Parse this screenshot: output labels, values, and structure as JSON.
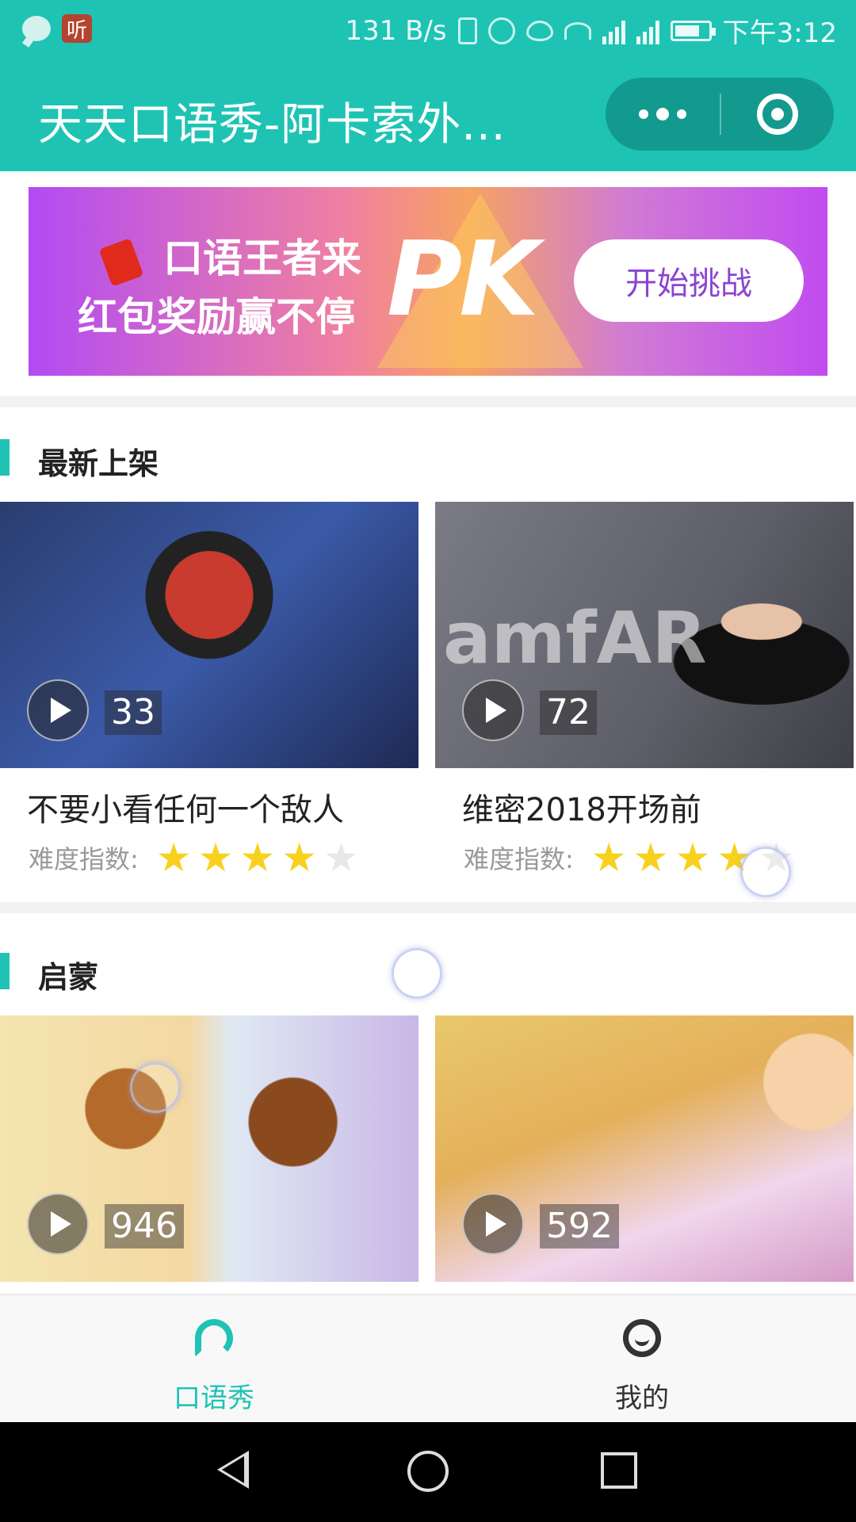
{
  "status_bar": {
    "speed": "131 B/s",
    "time": "下午3:12",
    "notif_badge": "听",
    "icons": [
      "chat-icon",
      "vibrate-icon",
      "alarm-icon",
      "eye-icon",
      "wifi-icon",
      "signal-4g-icon",
      "signal-2g-icon",
      "battery-icon"
    ]
  },
  "header": {
    "title": "天天口语秀-阿卡索外...",
    "accent_color": "#1ec3b4"
  },
  "banner": {
    "line1": "口语王者来",
    "line2": "红包奖励赢不停",
    "pk": "PK",
    "cta": "开始挑战"
  },
  "sections": [
    {
      "title": "最新上架",
      "cards": [
        {
          "title": "不要小看任何一个敌人",
          "count": "33",
          "difficulty_label": "难度指数:",
          "stars": 4,
          "max_stars": 5
        },
        {
          "title": "维密2018开场前",
          "count": "72",
          "difficulty_label": "难度指数:",
          "stars": 4,
          "max_stars": 5,
          "image_text": "amfAR"
        }
      ]
    },
    {
      "title": "启蒙",
      "cards": [
        {
          "count": "946"
        },
        {
          "count": "592"
        }
      ]
    }
  ],
  "tabbar": {
    "tabs": [
      {
        "label": "口语秀",
        "icon": "speech-icon",
        "active": true
      },
      {
        "label": "我的",
        "icon": "profile-icon",
        "active": false
      }
    ]
  }
}
